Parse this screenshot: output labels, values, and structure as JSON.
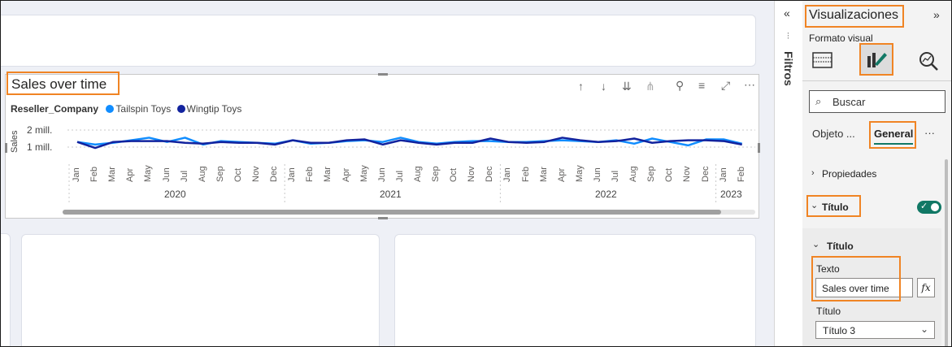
{
  "visual": {
    "title": "Sales over time",
    "legend_title": "Reseller_Company",
    "legend_items": [
      {
        "name": "Tailspin Toys",
        "color": "#118dff"
      },
      {
        "name": "Wingtip Toys",
        "color": "#12239e"
      }
    ],
    "y_axis_label": "Sales",
    "y_ticks": [
      "2 mill.",
      "1 mill."
    ],
    "months": [
      "Jan",
      "Feb",
      "Mar",
      "Apr",
      "May",
      "Jun",
      "Jul",
      "Aug",
      "Sep",
      "Oct",
      "Nov",
      "Dec",
      "Jan",
      "Feb",
      "Mar",
      "Apr",
      "May",
      "Jun",
      "Jul",
      "Aug",
      "Sep",
      "Oct",
      "Nov",
      "Dec",
      "Jan",
      "Feb",
      "Mar",
      "Apr",
      "May",
      "Jun",
      "Jul",
      "Aug",
      "Sep",
      "Oct",
      "Nov",
      "Dec",
      "Jan",
      "Feb"
    ],
    "years": [
      "2020",
      "2021",
      "2022",
      "2023"
    ],
    "header_icons": [
      "arrow-up-icon",
      "arrow-down-icon",
      "double-arrow-down-icon",
      "expand-hierarchy-icon",
      "pin-icon",
      "filter-icon",
      "focus-mode-icon",
      "more-options-icon"
    ]
  },
  "chart_data": {
    "type": "line",
    "title": "Sales over time",
    "ylabel": "Sales",
    "x": [
      "Jan 2020",
      "Feb 2020",
      "Mar 2020",
      "Apr 2020",
      "May 2020",
      "Jun 2020",
      "Jul 2020",
      "Aug 2020",
      "Sep 2020",
      "Oct 2020",
      "Nov 2020",
      "Dec 2020",
      "Jan 2021",
      "Feb 2021",
      "Mar 2021",
      "Apr 2021",
      "May 2021",
      "Jun 2021",
      "Jul 2021",
      "Aug 2021",
      "Sep 2021",
      "Oct 2021",
      "Nov 2021",
      "Dec 2021",
      "Jan 2022",
      "Feb 2022",
      "Mar 2022",
      "Apr 2022",
      "May 2022",
      "Jun 2022",
      "Jul 2022",
      "Aug 2022",
      "Sep 2022",
      "Oct 2022",
      "Nov 2022",
      "Dec 2022",
      "Jan 2023",
      "Feb 2023"
    ],
    "ylim": [
      0.9,
      2.1
    ],
    "y_ticks": [
      1,
      2
    ],
    "series": [
      {
        "name": "Tailspin Toys",
        "color": "#118dff",
        "values": [
          1.3,
          1.15,
          1.25,
          1.4,
          1.55,
          1.3,
          1.55,
          1.15,
          1.35,
          1.3,
          1.25,
          1.2,
          1.4,
          1.2,
          1.25,
          1.35,
          1.4,
          1.3,
          1.55,
          1.3,
          1.2,
          1.3,
          1.35,
          1.35,
          1.3,
          1.3,
          1.35,
          1.4,
          1.35,
          1.3,
          1.4,
          1.2,
          1.5,
          1.3,
          1.1,
          1.45,
          1.45,
          1.2
        ]
      },
      {
        "name": "Wingtip Toys",
        "color": "#12239e",
        "values": [
          1.3,
          0.95,
          1.3,
          1.35,
          1.35,
          1.35,
          1.25,
          1.2,
          1.3,
          1.25,
          1.25,
          1.15,
          1.4,
          1.25,
          1.25,
          1.4,
          1.45,
          1.15,
          1.4,
          1.25,
          1.15,
          1.25,
          1.25,
          1.5,
          1.3,
          1.25,
          1.3,
          1.55,
          1.4,
          1.3,
          1.35,
          1.5,
          1.25,
          1.35,
          1.4,
          1.4,
          1.35,
          1.15
        ]
      }
    ],
    "grid": true,
    "legend": "top-left"
  },
  "filters": {
    "label": "Filtros"
  },
  "pane": {
    "title": "Visualizaciones",
    "subtitle": "Formato visual",
    "search_placeholder": "Buscar",
    "tabs": [
      "Objeto ...",
      "General"
    ],
    "more": "···",
    "section_properties": "Propiedades",
    "section_title": "Título",
    "sub_title": "Título",
    "text_label": "Texto",
    "text_value": "Sales over time",
    "fx": "fx",
    "style_label": "Título",
    "style_value": "Título 3"
  }
}
